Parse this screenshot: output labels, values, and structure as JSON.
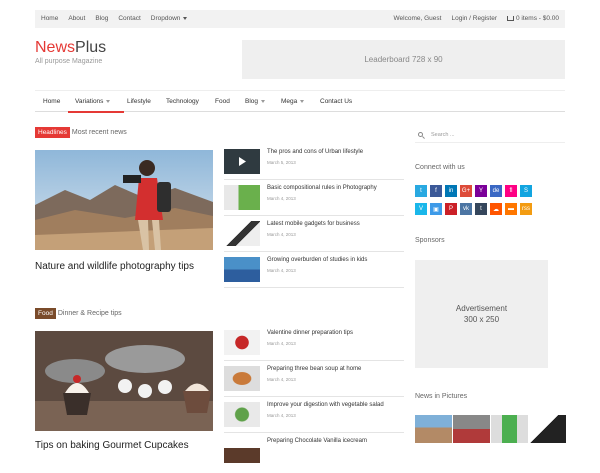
{
  "topbar": {
    "left_links": [
      "Home",
      "About",
      "Blog",
      "Contact",
      "Dropdown"
    ],
    "welcome": "Welcome, Guest",
    "login": "Login / Register",
    "cart": "0 items - $0.00"
  },
  "header": {
    "logo_brand": "News",
    "logo_suffix": "Plus",
    "tagline": "All purpose Magazine",
    "leaderboard": "Leaderboard 728 x 90"
  },
  "nav": {
    "items": [
      "Home",
      "Variations",
      "Lifestyle",
      "Technology",
      "Food",
      "Blog",
      "Mega",
      "Contact Us"
    ]
  },
  "headlines": {
    "badge": "Headlines",
    "subtitle": "Most recent news",
    "feature_title": "Nature and wildlife photography tips",
    "list": [
      {
        "title": "The pros and cons of Urban lifestyle",
        "date": "March 5, 2013"
      },
      {
        "title": "Basic compositional rules in Photography",
        "date": "March 4, 2013"
      },
      {
        "title": "Latest mobile gadgets for business",
        "date": "March 4, 2013"
      },
      {
        "title": "Growing overburden of studies in kids",
        "date": "March 4, 2013"
      }
    ]
  },
  "food": {
    "badge": "Food",
    "subtitle": "Dinner & Recipe tips",
    "feature_title": "Tips on baking Gourmet Cupcakes",
    "list": [
      {
        "title": "Valentine dinner preparation tips",
        "date": "March 4, 2013"
      },
      {
        "title": "Preparing three bean soup at home",
        "date": "March 4, 2013"
      },
      {
        "title": "Improve your digestion with vegetable salad",
        "date": "March 4, 2013"
      },
      {
        "title": "Preparing Chocolate Vanilla icecream",
        "date": ""
      }
    ]
  },
  "sidebar": {
    "search_placeholder": "Search ...",
    "connect_heading": "Connect with us",
    "social_row1": [
      "t",
      "f",
      "in",
      "G+",
      "Y",
      "de",
      "fl",
      "S"
    ],
    "social_row2": [
      "V",
      "▣",
      "P",
      "vk",
      "t",
      "☁",
      "▬",
      "rss"
    ],
    "sponsors_heading": "Sponsors",
    "ad_line1": "Advertisement",
    "ad_line2": "300 x 250",
    "pictures_heading": "News in Pictures"
  },
  "colors": {
    "accent": "#e53935",
    "food_badge": "#7a4b2a",
    "social_row1": [
      "#29a9e1",
      "#3b5998",
      "#0077b5",
      "#dd4b39",
      "#7b0099",
      "#3b68c4",
      "#ff0084",
      "#12a5e0"
    ],
    "social_row2": [
      "#1ab7ea",
      "#3d9ae8",
      "#cb2027",
      "#4c75a3",
      "#35465c",
      "#ff5500",
      "#ff7700",
      "#f39c12"
    ]
  }
}
